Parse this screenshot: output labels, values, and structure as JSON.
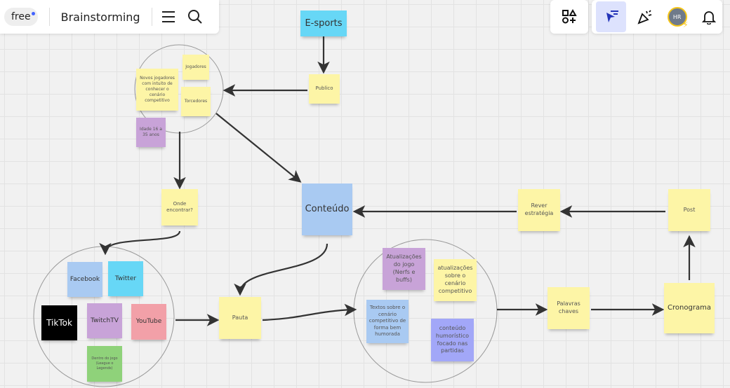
{
  "toolbar": {
    "plan_badge": "free",
    "board_title": "Brainstorming",
    "avatar_initials": "HR"
  },
  "notes": {
    "esports": "E-sports",
    "publico": "Publico",
    "jogadores": "Jogadores",
    "novos": "Novos jogadores com intuito de conhecer o cenário competitivo",
    "torcedores": "Torcedores",
    "idade": "Idade 16 a 35 anos",
    "onde": "Onde encontrar?",
    "conteudo": "Conteúdo",
    "rever": "Rever estratégia",
    "post": "Post",
    "facebook": "Facebook",
    "twitter": "Twitter",
    "tiktok": "TikTok",
    "twitchtv": "TwitchTV",
    "youtube": "YouTube",
    "dentro": "Dentro do jogo (League o Legends)",
    "pauta": "Pauta",
    "atual_jogo": "Atualizações do jogo (Nerfs e buffs)",
    "atual_cenario": "atualizações sobre o cenário competitivo",
    "textos": "Textos sobre o cenário competitivo de forma bem humorada",
    "humor": "conteúdo humorístico focado nas partidas",
    "palavras": "Palavras chaves",
    "cronograma": "Cronograma"
  },
  "colors": {
    "yellow": "#fdf5a6",
    "cyan": "#67d7f6",
    "blue": "#a9caf2",
    "purple": "#c8a3d8",
    "red": "#f2a0a8",
    "green": "#8fd27a",
    "violet": "#a2a7f8",
    "accent": "#4262ff"
  }
}
